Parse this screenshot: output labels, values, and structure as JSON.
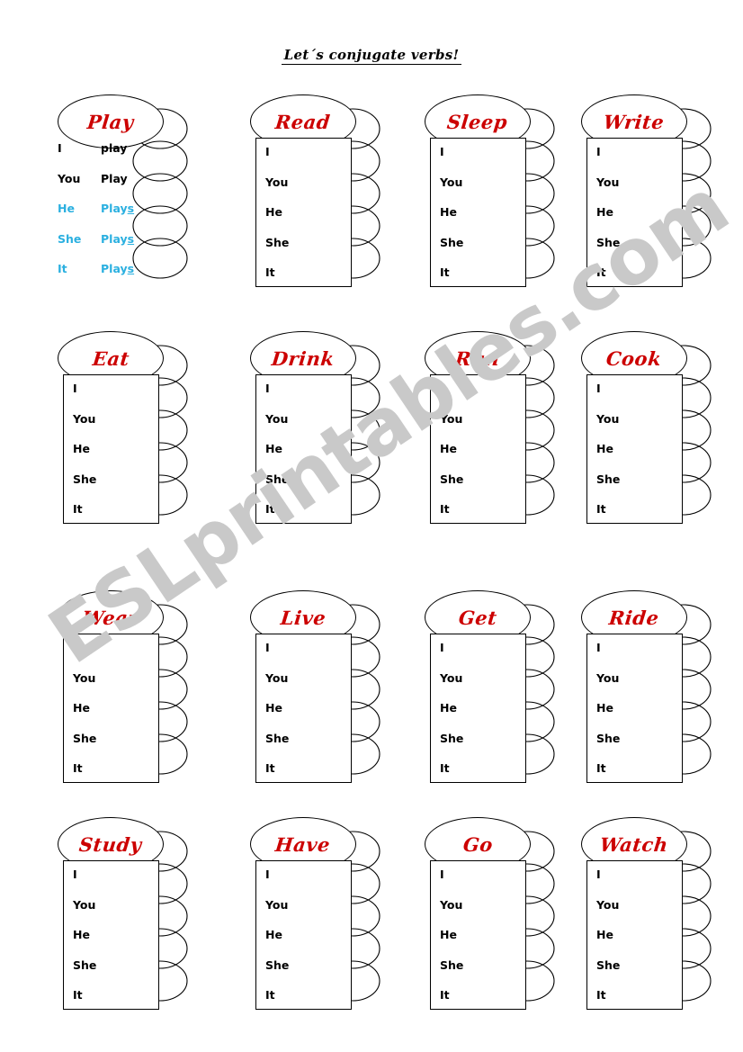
{
  "page": {
    "title": "Let´s conjugate verbs!",
    "watermark": "ESLprintables.com",
    "colors": {
      "verb_red": "#cc0000",
      "example_blue": "#2bb0e0",
      "ink_black": "#000000",
      "watermark_gray": "#c9c9c9",
      "paper": "#ffffff"
    }
  },
  "pronouns": [
    "I",
    "You",
    "He",
    "She",
    "It"
  ],
  "example": {
    "verb": "Play",
    "rows": [
      {
        "pronoun": "I",
        "answer": "play",
        "color": "black",
        "underline_last": false
      },
      {
        "pronoun": "You",
        "answer": "Play",
        "color": "black",
        "underline_last": false
      },
      {
        "pronoun": "He",
        "answer": "Plays",
        "color": "blue",
        "underline_last": true
      },
      {
        "pronoun": "She",
        "answer": "Plays",
        "color": "blue",
        "underline_last": true
      },
      {
        "pronoun": "It",
        "answer": "Plays",
        "color": "blue",
        "underline_last": true
      }
    ]
  },
  "cards": [
    {
      "verb": "Play",
      "is_example": true
    },
    {
      "verb": "Read",
      "is_example": false
    },
    {
      "verb": "Sleep",
      "is_example": false
    },
    {
      "verb": "Write",
      "is_example": false
    },
    {
      "verb": "Eat",
      "is_example": false
    },
    {
      "verb": "Drink",
      "is_example": false
    },
    {
      "verb": "Run",
      "is_example": false
    },
    {
      "verb": "Cook",
      "is_example": false
    },
    {
      "verb": "Wear",
      "is_example": false
    },
    {
      "verb": "Live",
      "is_example": false
    },
    {
      "verb": "Get",
      "is_example": false
    },
    {
      "verb": "Ride",
      "is_example": false
    },
    {
      "verb": "Study",
      "is_example": false
    },
    {
      "verb": "Have",
      "is_example": false
    },
    {
      "verb": "Go",
      "is_example": false
    },
    {
      "verb": "Watch",
      "is_example": false
    }
  ],
  "layout": {
    "columns_x": [
      58,
      272,
      466,
      640
    ],
    "rows_y": [
      105,
      368,
      656,
      908
    ]
  }
}
